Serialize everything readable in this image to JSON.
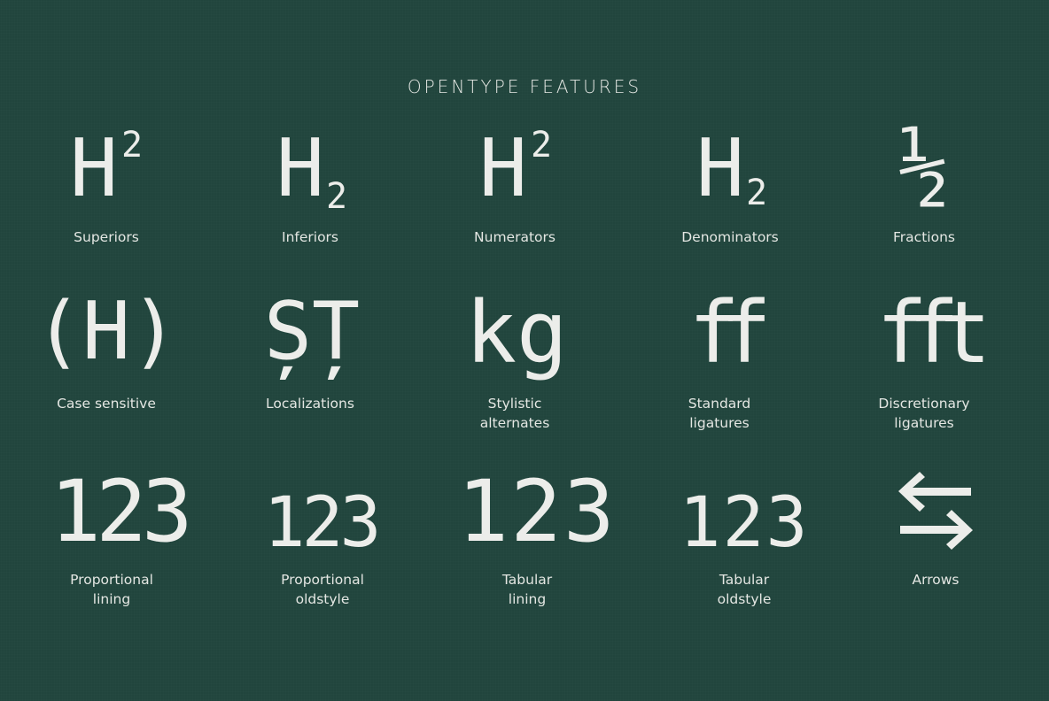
{
  "title": "OPENTYPE FEATURES",
  "features": [
    {
      "glyph_main": "H",
      "glyph_mark": "2",
      "label_lines": [
        "Superiors"
      ]
    },
    {
      "glyph_main": "H",
      "glyph_mark": "2",
      "label_lines": [
        "Inferiors"
      ]
    },
    {
      "glyph_main": "H",
      "glyph_mark": "2",
      "label_lines": [
        "Numerators"
      ]
    },
    {
      "glyph_main": "H",
      "glyph_mark": "2",
      "label_lines": [
        "Denominators"
      ]
    },
    {
      "glyph_main": "½",
      "label_lines": [
        "Fractions"
      ]
    },
    {
      "glyph_main": "(H)",
      "label_lines": [
        "Case sensitive"
      ]
    },
    {
      "glyph_main": "ȘȚ",
      "label_lines": [
        "Localizations"
      ]
    },
    {
      "glyph_main": "kg",
      "label_lines": [
        "Stylistic",
        "alternates"
      ]
    },
    {
      "glyph_main": "ff",
      "label_lines": [
        "Standard",
        "ligatures"
      ]
    },
    {
      "glyph_main": "fft",
      "label_lines": [
        "Discretionary",
        "ligatures"
      ]
    },
    {
      "glyph_main": "123",
      "label_lines": [
        "Proportional",
        "lining"
      ]
    },
    {
      "glyph_main": "123",
      "label_lines": [
        "Proportional",
        "oldstyle"
      ]
    },
    {
      "glyph_main": "123",
      "label_lines": [
        "Tabular",
        "lining"
      ]
    },
    {
      "glyph_main": "123",
      "label_lines": [
        "Tabular",
        "oldstyle"
      ]
    },
    {
      "glyph_icon": "left-right-arrows-icon",
      "label_lines": [
        "Arrows"
      ]
    }
  ]
}
